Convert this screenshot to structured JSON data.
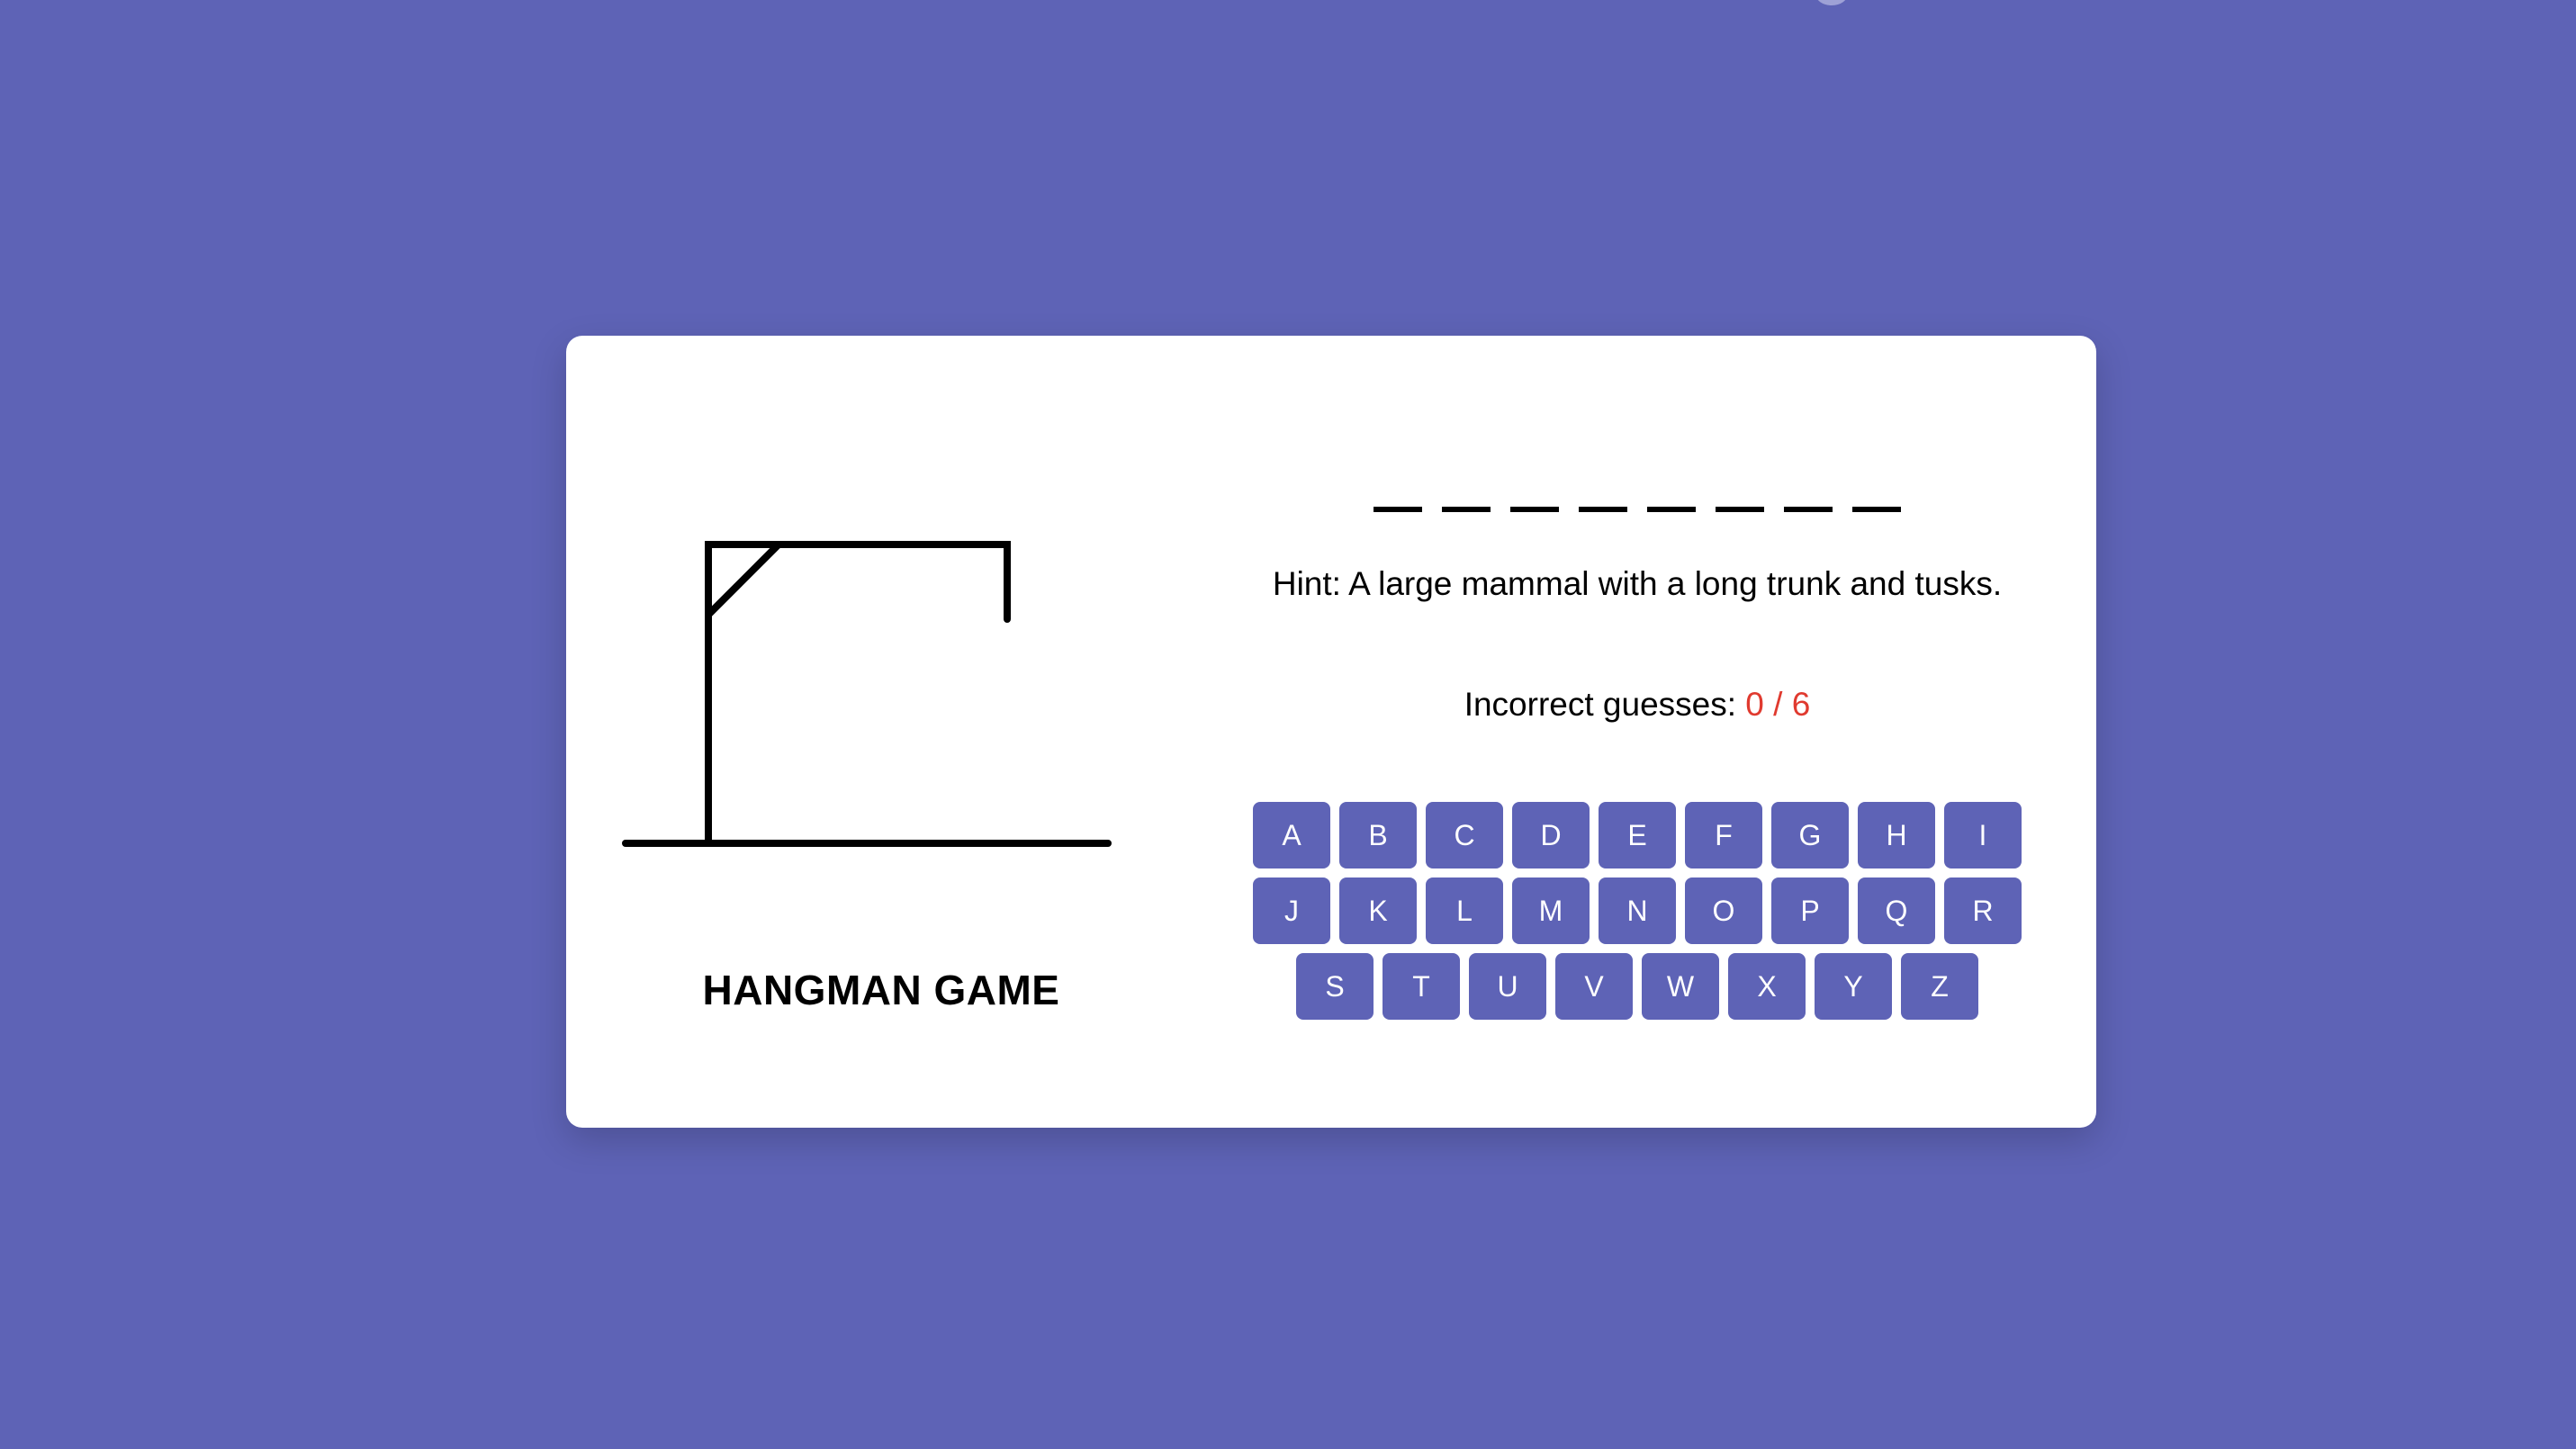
{
  "app": {
    "accent_color": "#5E63B6",
    "background_color": "#5E63B6",
    "card_color": "#FFFFFF",
    "count_color": "#E03A2F"
  },
  "hangman": {
    "title": "HANGMAN GAME",
    "wrong_parts_drawn": 0
  },
  "game": {
    "word_length": 8,
    "revealed_letters": [
      "",
      "",
      "",
      "",
      "",
      "",
      "",
      ""
    ],
    "hint_text": "Hint: A large mammal with a long trunk and tusks.",
    "incorrect_label": "Incorrect guesses:",
    "incorrect_count": "0 / 6"
  },
  "keyboard": {
    "rows": [
      [
        "A",
        "B",
        "C",
        "D",
        "E",
        "F",
        "G",
        "H",
        "I"
      ],
      [
        "J",
        "K",
        "L",
        "M",
        "N",
        "O",
        "P",
        "Q",
        "R"
      ],
      [
        "S",
        "T",
        "U",
        "V",
        "W",
        "X",
        "Y",
        "Z"
      ]
    ]
  }
}
